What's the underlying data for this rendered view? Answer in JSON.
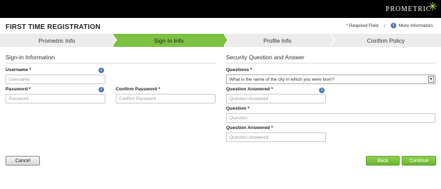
{
  "brand": {
    "logo_text": "PROMETRIC"
  },
  "header": {
    "title": "FIRST TIME REGISTRATION",
    "required_note": "* Required Field",
    "divider": "|",
    "more_info": "More Information",
    "info_glyph": "i"
  },
  "steps": [
    {
      "label": "Prometric Info",
      "active": false
    },
    {
      "label": "Sign In Info",
      "active": true
    },
    {
      "label": "Profile Info",
      "active": false
    },
    {
      "label": "Confirm Policy",
      "active": false
    }
  ],
  "signin": {
    "title": "Sign-in Information",
    "username_label": "Username",
    "username_placeholder": "Username",
    "password_label": "Password",
    "password_placeholder": "Password",
    "confirm_label": "Confirm Password",
    "confirm_placeholder": "Confirm Password",
    "required_marker": "*"
  },
  "security": {
    "title": "Security Question and Answer",
    "questions_label": "Questions",
    "questions_selected": "What is the name of the city in which you were born?",
    "answer1_label": "Question Answered",
    "answer1_placeholder": "Question Answered",
    "question_label": "Question",
    "question_placeholder": "Question",
    "answer2_label": "Question Answered",
    "answer2_placeholder": "Question Answered",
    "required_marker": "*"
  },
  "buttons": {
    "cancel": "Cancel",
    "back": "Back",
    "continue": "Continue"
  },
  "colors": {
    "accent": "#7cc142",
    "step_inactive": "#ececec",
    "topbar": "#000000",
    "info": "#4a78b0"
  }
}
